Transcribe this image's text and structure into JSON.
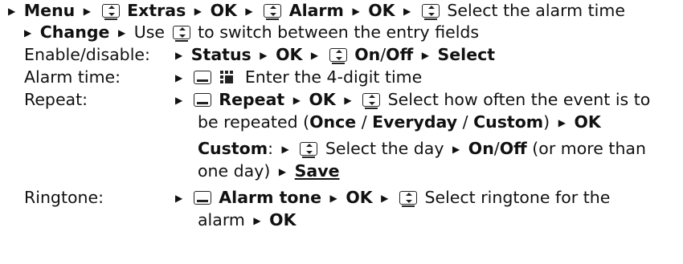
{
  "line1": {
    "menu": "Menu",
    "extras": "Extras",
    "ok1": "OK",
    "alarm": "Alarm",
    "ok2": "OK",
    "select_time": "Select the alarm time"
  },
  "line2": {
    "change": "Change",
    "use": "Use",
    "switch_text": "to switch between the entry fields"
  },
  "enable": {
    "label": "Enable/disable:",
    "status": "Status",
    "ok": "OK",
    "on": "On",
    "slash": "/",
    "off": "Off",
    "select": "Select"
  },
  "alarm_time": {
    "label": "Alarm time:",
    "text": "Enter the 4-digit time"
  },
  "repeat": {
    "label": "Repeat:",
    "repeat": "Repeat",
    "ok": "OK",
    "text1": "Select how often the event is to",
    "text2a": "be repeated (",
    "once": "Once",
    "sep1": " / ",
    "everyday": "Everyday",
    "sep2": " / ",
    "custom": "Custom",
    "text2b": ")",
    "ok2": "OK",
    "custom_label": "Custom",
    "colon": ":",
    "select_day": "Select the day",
    "on": "On",
    "slash": "/",
    "off": "Off",
    "more": "(or more than",
    "one_day": "one day)",
    "save": "Save"
  },
  "ringtone": {
    "label": "Ringtone:",
    "alarm_tone": "Alarm tone",
    "ok": "OK",
    "text": "Select ringtone for the",
    "alarm": "alarm",
    "ok2": "OK"
  }
}
